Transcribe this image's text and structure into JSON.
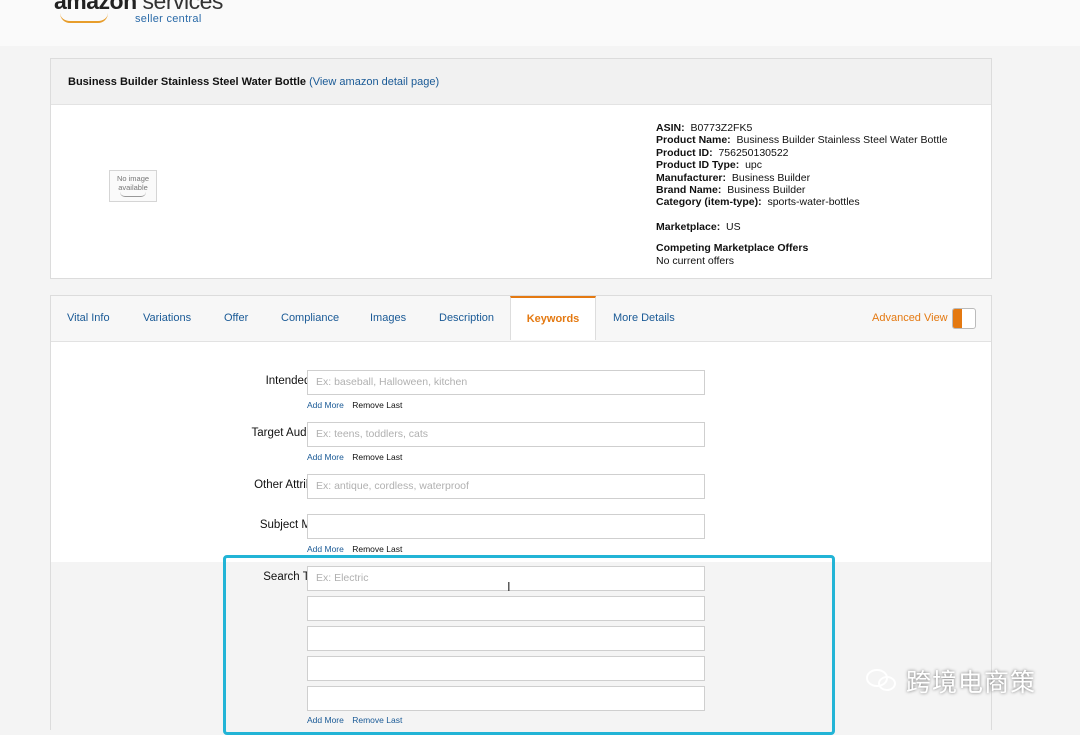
{
  "header": {
    "logo_main_a": "amazon",
    "logo_main_b": "services",
    "logo_sub": "seller central"
  },
  "product": {
    "title": "Business Builder Stainless Steel Water Bottle",
    "link_text": "(View amazon detail page)",
    "no_image_line1": "No image",
    "no_image_line2": "available",
    "details": {
      "asin_label": "ASIN:",
      "asin": "B0773Z2FK5",
      "name_label": "Product Name:",
      "name": "Business Builder Stainless Steel Water Bottle",
      "id_label": "Product ID:",
      "id": "756250130522",
      "id_type_label": "Product ID Type:",
      "id_type": "upc",
      "manufacturer_label": "Manufacturer:",
      "manufacturer": "Business Builder",
      "brand_label": "Brand Name:",
      "brand": "Business Builder",
      "category_label": "Category (item-type):",
      "category": "sports-water-bottles",
      "marketplace_label": "Marketplace:",
      "marketplace": "US",
      "offers_label": "Competing Marketplace Offers",
      "offers": "No current offers"
    }
  },
  "tabs": [
    {
      "label": "Vital Info"
    },
    {
      "label": "Variations"
    },
    {
      "label": "Offer"
    },
    {
      "label": "Compliance"
    },
    {
      "label": "Images"
    },
    {
      "label": "Description"
    },
    {
      "label": "Keywords",
      "active": true
    },
    {
      "label": "More Details"
    }
  ],
  "advanced_view": "Advanced View",
  "form": {
    "intended_use": {
      "label": "Intended Use",
      "placeholder": "Ex: baseball, Halloween, kitchen"
    },
    "target_audience": {
      "label": "Target Audience",
      "placeholder": "Ex: teens, toddlers, cats"
    },
    "other_attributes": {
      "label": "Other Attributes",
      "placeholder": "Ex: antique, cordless, waterproof"
    },
    "subject_matter": {
      "label": "Subject Matter",
      "placeholder": ""
    },
    "search_terms": {
      "label": "Search Terms",
      "placeholder": "Ex: Electric"
    },
    "add_more": "Add More",
    "remove_last": "Remove Last"
  },
  "watermark": "跨境电商策",
  "colors": {
    "accent": "#e47911",
    "link": "#1a5a96",
    "highlight": "#22b4d6"
  }
}
